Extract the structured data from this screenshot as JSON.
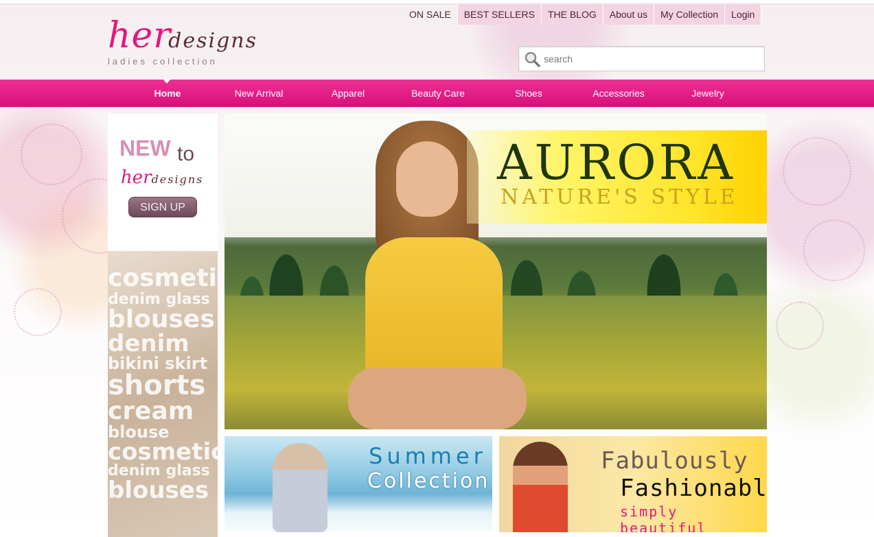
{
  "header": {
    "logo": {
      "her": "her",
      "designs": "designs",
      "tagline": "ladies collection"
    },
    "top_links": [
      "ON SALE",
      "BEST SELLERS",
      "THE BLOG",
      "About us",
      "My Collection",
      "Login"
    ],
    "search": {
      "placeholder": "search"
    }
  },
  "nav": {
    "items": [
      "Home",
      "New Arrival",
      "Apparel",
      "Beauty Care",
      "Shoes",
      "Accessories",
      "Jewelry"
    ],
    "active": "Home"
  },
  "sidebar": {
    "new": "NEW",
    "to": "to",
    "brand_her": "her",
    "brand_designs": "designs",
    "signup_label": "SIGN UP",
    "word_cloud": [
      "cosmetic",
      "denim glass",
      "blouses",
      "denim",
      "bikini skirt",
      "shorts",
      "cream",
      "blouse",
      "cosmetic",
      "denim glass",
      "blouses"
    ]
  },
  "hero": {
    "title": "AURORA",
    "subtitle": "NATURE'S STYLE"
  },
  "promos": [
    {
      "line1": "Summer",
      "line2": "Collection"
    },
    {
      "line1": "Fabulously",
      "line2": "Fashionable",
      "line3": "simply beautiful"
    }
  ],
  "colors": {
    "brand_pink": "#e4177b",
    "nav_pink": "#e01d86"
  }
}
